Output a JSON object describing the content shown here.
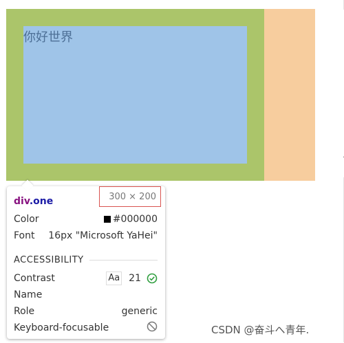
{
  "page": {
    "content_text": "你好世界"
  },
  "tooltip": {
    "element_tag": "div",
    "element_class": ".one",
    "dimensions": "300 × 200",
    "color_label": "Color",
    "color_value": "#000000",
    "font_label": "Font",
    "font_value": "16px \"Microsoft YaHei\"",
    "accessibility_heading": "ACCESSIBILITY",
    "contrast_label": "Contrast",
    "contrast_aa": "Aa",
    "contrast_value": "21",
    "name_label": "Name",
    "role_label": "Role",
    "role_value": "generic",
    "keyboard_label": "Keyboard-focusable"
  },
  "watermark": "CSDN @奋斗へ青年.",
  "colors": {
    "margin": "#f7cd9e",
    "padding": "#abc56a",
    "content": "#9fc4e8",
    "check": "#2e9e3e"
  },
  "icons": [
    "check-circle-icon",
    "blocked-icon"
  ]
}
